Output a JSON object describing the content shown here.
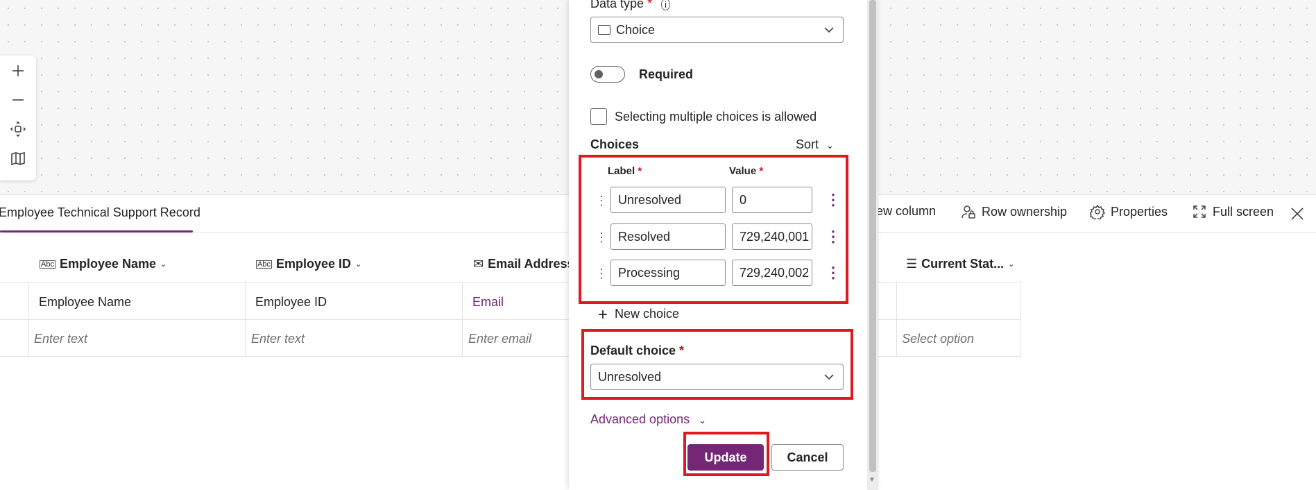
{
  "colors": {
    "accent": "#742774",
    "highlight": "#e0191e",
    "required": "#c50f1f"
  },
  "canvas": {
    "zoom_toolbar": [
      {
        "icon": "zoom-in-icon"
      },
      {
        "icon": "zoom-out-icon"
      },
      {
        "icon": "fit-view-icon"
      },
      {
        "icon": "map-icon"
      }
    ]
  },
  "table": {
    "title": "Employee Technical Support Record",
    "toolbar": {
      "new_column": "ew column",
      "row_ownership": "Row ownership",
      "properties": "Properties",
      "full_screen": "Full screen"
    },
    "columns": [
      {
        "label": "Employee Name",
        "icon": "text-type-icon",
        "value": "Employee Name",
        "placeholder": "Enter text"
      },
      {
        "label": "Employee ID",
        "icon": "text-type-icon",
        "value": "Employee ID",
        "placeholder": "Enter text"
      },
      {
        "label": "Email Address",
        "icon": "email-type-icon",
        "value": "Email",
        "placeholder": "Enter email"
      },
      {
        "label": "Current Stat...",
        "icon": "choice-type-icon",
        "value": "",
        "placeholder": "Select option"
      }
    ],
    "abc_glyph": "Abc"
  },
  "panel": {
    "data_type_label": "Data type",
    "data_type_value": "Choice",
    "required_label": "Required",
    "multiple_label": "Selecting multiple choices is allowed",
    "choices_heading": "Choices",
    "sort_label": "Sort",
    "label_header": "Label",
    "value_header": "Value",
    "choices": [
      {
        "label": "Unresolved",
        "value": "0"
      },
      {
        "label": "Resolved",
        "value": "729,240,001"
      },
      {
        "label": "Processing",
        "value": "729,240,002"
      }
    ],
    "new_choice": "New choice",
    "default_choice_label": "Default choice",
    "default_choice_value": "Unresolved",
    "advanced_options": "Advanced options",
    "update_button": "Update",
    "cancel_button": "Cancel",
    "required_mark": "*"
  }
}
